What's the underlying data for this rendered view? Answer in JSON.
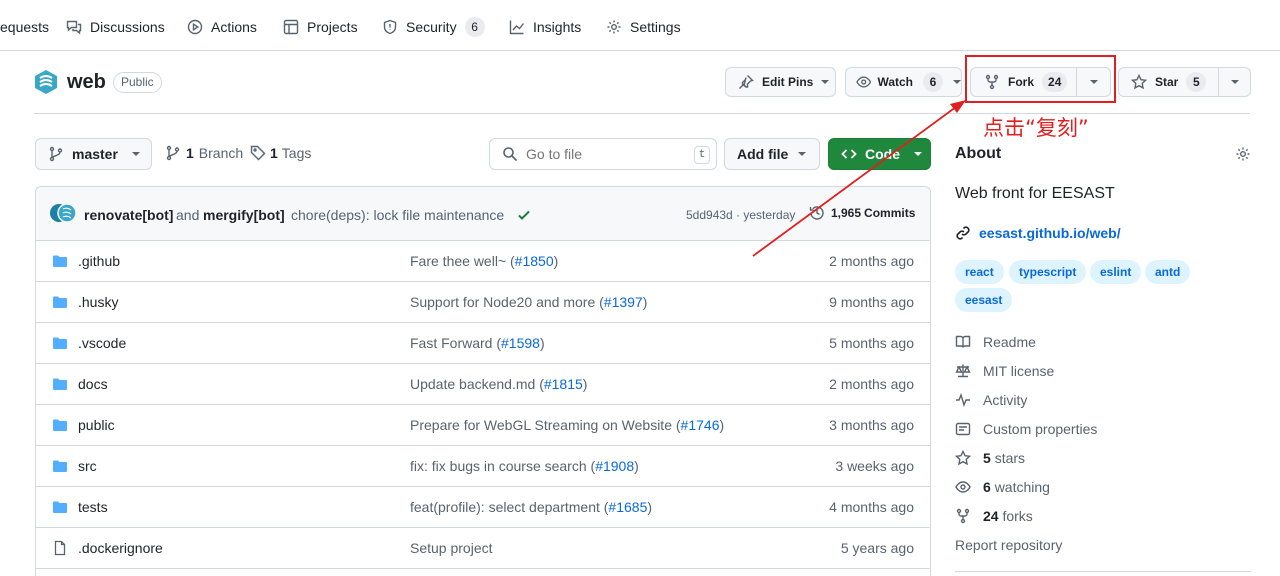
{
  "topnav": {
    "items": [
      {
        "label": "equests",
        "icon": "pull-request-icon"
      },
      {
        "label": "Discussions",
        "icon": "comment-discussion-icon"
      },
      {
        "label": "Actions",
        "icon": "play-icon"
      },
      {
        "label": "Projects",
        "icon": "table-icon"
      },
      {
        "label": "Security",
        "icon": "shield-icon",
        "count": "6"
      },
      {
        "label": "Insights",
        "icon": "graph-icon"
      },
      {
        "label": "Settings",
        "icon": "gear-icon"
      }
    ]
  },
  "repo": {
    "name": "web",
    "visibility": "Public",
    "edit_pins": "Edit Pins",
    "watch_label": "Watch",
    "watch_count": "6",
    "fork_label": "Fork",
    "fork_count": "24",
    "star_label": "Star",
    "star_count": "5"
  },
  "toolbar": {
    "branch": "master",
    "branch_count": "1",
    "branch_label": "Branch",
    "tag_count": "1",
    "tag_label": "Tags",
    "goto_placeholder": "Go to file",
    "goto_shortcut": "t",
    "add_file": "Add file",
    "code": "Code"
  },
  "commit": {
    "author1": "renovate[bot]",
    "and": "and",
    "author2": "mergify[bot]",
    "message": "chore(deps): lock file maintenance",
    "meta": "5dd943d · yesterday",
    "commits_count": "1,965",
    "commits_label": "Commits"
  },
  "files": [
    {
      "name": ".github",
      "type": "folder",
      "msg": "Fare thee well~ (",
      "pr": "#1850",
      "msg_end": ")",
      "date": "2 months ago"
    },
    {
      "name": ".husky",
      "type": "folder",
      "msg": "Support for Node20 and more (",
      "pr": "#1397",
      "msg_end": ")",
      "date": "9 months ago"
    },
    {
      "name": ".vscode",
      "type": "folder",
      "msg": "Fast Forward (",
      "pr": "#1598",
      "msg_end": ")",
      "date": "5 months ago"
    },
    {
      "name": "docs",
      "type": "folder",
      "msg": "Update backend.md (",
      "pr": "#1815",
      "msg_end": ")",
      "date": "2 months ago"
    },
    {
      "name": "public",
      "type": "folder",
      "msg": "Prepare for WebGL Streaming on Website (",
      "pr": "#1746",
      "msg_end": ")",
      "date": "3 months ago"
    },
    {
      "name": "src",
      "type": "folder",
      "msg": "fix: fix bugs in course search (",
      "pr": "#1908",
      "msg_end": ")",
      "date": "3 weeks ago"
    },
    {
      "name": "tests",
      "type": "folder",
      "msg": "feat(profile): select department (",
      "pr": "#1685",
      "msg_end": ")",
      "date": "4 months ago"
    },
    {
      "name": ".dockerignore",
      "type": "file",
      "msg": "Setup project",
      "pr": "",
      "msg_end": "",
      "date": "5 years ago"
    }
  ],
  "about": {
    "title": "About",
    "description": "Web front for EESAST",
    "website": "eesast.github.io/web/",
    "topics": [
      "react",
      "typescript",
      "eslint",
      "antd",
      "eesast"
    ],
    "readme": "Readme",
    "license": "MIT license",
    "activity": "Activity",
    "custom_properties": "Custom properties",
    "stars_count": "5",
    "stars_label": "stars",
    "watching_count": "6",
    "watching_label": "watching",
    "forks_count": "24",
    "forks_label": "forks",
    "report": "Report repository"
  },
  "annotation": {
    "text": "点击“复刻”",
    "color": "#e02020"
  },
  "colors": {
    "accent": "#0969da",
    "code_button": "#1f883d",
    "folder": "#54aeff"
  }
}
